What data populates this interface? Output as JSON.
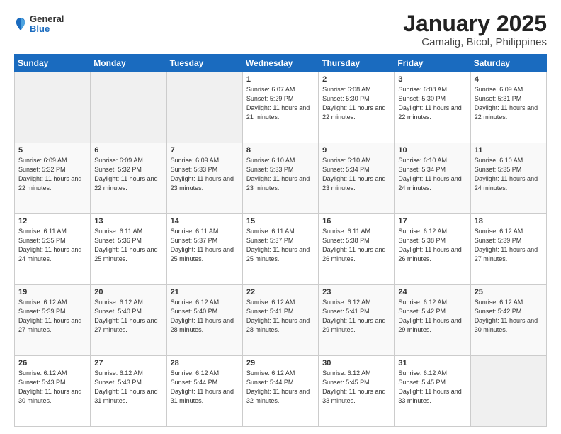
{
  "logo": {
    "general": "General",
    "blue": "Blue"
  },
  "title": "January 2025",
  "subtitle": "Camalig, Bicol, Philippines",
  "days": [
    "Sunday",
    "Monday",
    "Tuesday",
    "Wednesday",
    "Thursday",
    "Friday",
    "Saturday"
  ],
  "weeks": [
    [
      {
        "day": "",
        "empty": true
      },
      {
        "day": "",
        "empty": true
      },
      {
        "day": "",
        "empty": true
      },
      {
        "day": "1",
        "sunrise": "6:07 AM",
        "sunset": "5:29 PM",
        "daylight": "11 hours and 21 minutes."
      },
      {
        "day": "2",
        "sunrise": "6:08 AM",
        "sunset": "5:30 PM",
        "daylight": "11 hours and 22 minutes."
      },
      {
        "day": "3",
        "sunrise": "6:08 AM",
        "sunset": "5:30 PM",
        "daylight": "11 hours and 22 minutes."
      },
      {
        "day": "4",
        "sunrise": "6:09 AM",
        "sunset": "5:31 PM",
        "daylight": "11 hours and 22 minutes."
      }
    ],
    [
      {
        "day": "5",
        "sunrise": "6:09 AM",
        "sunset": "5:32 PM",
        "daylight": "11 hours and 22 minutes."
      },
      {
        "day": "6",
        "sunrise": "6:09 AM",
        "sunset": "5:32 PM",
        "daylight": "11 hours and 22 minutes."
      },
      {
        "day": "7",
        "sunrise": "6:09 AM",
        "sunset": "5:33 PM",
        "daylight": "11 hours and 23 minutes."
      },
      {
        "day": "8",
        "sunrise": "6:10 AM",
        "sunset": "5:33 PM",
        "daylight": "11 hours and 23 minutes."
      },
      {
        "day": "9",
        "sunrise": "6:10 AM",
        "sunset": "5:34 PM",
        "daylight": "11 hours and 23 minutes."
      },
      {
        "day": "10",
        "sunrise": "6:10 AM",
        "sunset": "5:34 PM",
        "daylight": "11 hours and 24 minutes."
      },
      {
        "day": "11",
        "sunrise": "6:10 AM",
        "sunset": "5:35 PM",
        "daylight": "11 hours and 24 minutes."
      }
    ],
    [
      {
        "day": "12",
        "sunrise": "6:11 AM",
        "sunset": "5:35 PM",
        "daylight": "11 hours and 24 minutes."
      },
      {
        "day": "13",
        "sunrise": "6:11 AM",
        "sunset": "5:36 PM",
        "daylight": "11 hours and 25 minutes."
      },
      {
        "day": "14",
        "sunrise": "6:11 AM",
        "sunset": "5:37 PM",
        "daylight": "11 hours and 25 minutes."
      },
      {
        "day": "15",
        "sunrise": "6:11 AM",
        "sunset": "5:37 PM",
        "daylight": "11 hours and 25 minutes."
      },
      {
        "day": "16",
        "sunrise": "6:11 AM",
        "sunset": "5:38 PM",
        "daylight": "11 hours and 26 minutes."
      },
      {
        "day": "17",
        "sunrise": "6:12 AM",
        "sunset": "5:38 PM",
        "daylight": "11 hours and 26 minutes."
      },
      {
        "day": "18",
        "sunrise": "6:12 AM",
        "sunset": "5:39 PM",
        "daylight": "11 hours and 27 minutes."
      }
    ],
    [
      {
        "day": "19",
        "sunrise": "6:12 AM",
        "sunset": "5:39 PM",
        "daylight": "11 hours and 27 minutes."
      },
      {
        "day": "20",
        "sunrise": "6:12 AM",
        "sunset": "5:40 PM",
        "daylight": "11 hours and 27 minutes."
      },
      {
        "day": "21",
        "sunrise": "6:12 AM",
        "sunset": "5:40 PM",
        "daylight": "11 hours and 28 minutes."
      },
      {
        "day": "22",
        "sunrise": "6:12 AM",
        "sunset": "5:41 PM",
        "daylight": "11 hours and 28 minutes."
      },
      {
        "day": "23",
        "sunrise": "6:12 AM",
        "sunset": "5:41 PM",
        "daylight": "11 hours and 29 minutes."
      },
      {
        "day": "24",
        "sunrise": "6:12 AM",
        "sunset": "5:42 PM",
        "daylight": "11 hours and 29 minutes."
      },
      {
        "day": "25",
        "sunrise": "6:12 AM",
        "sunset": "5:42 PM",
        "daylight": "11 hours and 30 minutes."
      }
    ],
    [
      {
        "day": "26",
        "sunrise": "6:12 AM",
        "sunset": "5:43 PM",
        "daylight": "11 hours and 30 minutes."
      },
      {
        "day": "27",
        "sunrise": "6:12 AM",
        "sunset": "5:43 PM",
        "daylight": "11 hours and 31 minutes."
      },
      {
        "day": "28",
        "sunrise": "6:12 AM",
        "sunset": "5:44 PM",
        "daylight": "11 hours and 31 minutes."
      },
      {
        "day": "29",
        "sunrise": "6:12 AM",
        "sunset": "5:44 PM",
        "daylight": "11 hours and 32 minutes."
      },
      {
        "day": "30",
        "sunrise": "6:12 AM",
        "sunset": "5:45 PM",
        "daylight": "11 hours and 33 minutes."
      },
      {
        "day": "31",
        "sunrise": "6:12 AM",
        "sunset": "5:45 PM",
        "daylight": "11 hours and 33 minutes."
      },
      {
        "day": "",
        "empty": true
      }
    ]
  ]
}
